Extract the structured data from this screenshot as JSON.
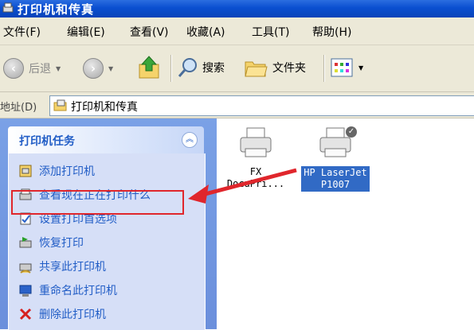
{
  "window": {
    "title": "打印机和传真"
  },
  "menu": [
    "文件(F)",
    "编辑(E)",
    "查看(V)",
    "收藏(A)",
    "工具(T)",
    "帮助(H)"
  ],
  "toolbar": {
    "back_label": "后退",
    "search_label": "搜索",
    "folders_label": "文件夹"
  },
  "address": {
    "label": "地址(D)",
    "value": "打印机和传真"
  },
  "task_pane": {
    "header": "打印机任务",
    "items": [
      "添加打印机",
      "查看现在正在打印什么",
      "设置打印首选项",
      "恢复打印",
      "共享此打印机",
      "重命名此打印机",
      "删除此打印机"
    ]
  },
  "printers": [
    {
      "name_line1": "FX",
      "name_line2": "DocuPri...",
      "selected": false
    },
    {
      "name_line1": "HP LaserJet",
      "name_line2": "P1007",
      "selected": true,
      "default": true
    }
  ],
  "colors": {
    "title_bar": "#0a4fd0",
    "task_link": "#215dc6",
    "highlight": "#e0262c",
    "selection": "#316ac5"
  },
  "icons": [
    "window-icon",
    "back-arrow-icon",
    "forward-arrow-icon",
    "up-folder-icon",
    "search-icon",
    "folders-icon",
    "views-icon",
    "address-folder-icon",
    "collapse-icon",
    "printer-icon",
    "default-check-icon"
  ]
}
